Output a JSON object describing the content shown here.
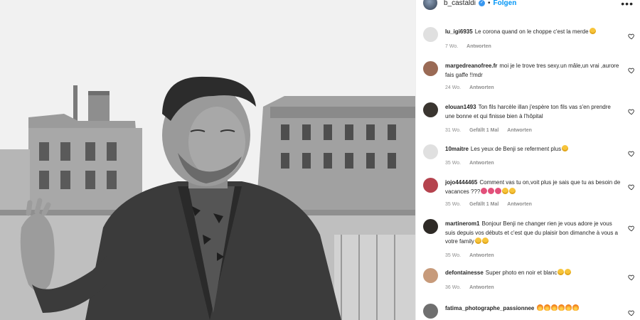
{
  "header": {
    "username": "b_castaldi",
    "separator": "•",
    "follow_label": "Folgen",
    "more_icon": "more-dots-icon"
  },
  "comments": [
    {
      "username": "lu_igi6935",
      "text": "Le corona quand on le choppe c'est la merde",
      "emojis": [
        "laugh"
      ],
      "time": "7 Wo.",
      "likes": "",
      "reply": "Antworten",
      "avatar_color": "#e0e0e0"
    },
    {
      "username": "margedreanofree.fr",
      "text": "moi je le trove tres sexy.un mâle,un vrai ,aurore fais gaffe !!mdr",
      "emojis": [],
      "time": "24 Wo.",
      "likes": "",
      "reply": "Antworten",
      "avatar_color": "#9a6a55"
    },
    {
      "username": "elouan1493",
      "text": "Ton fils harcèle illan j'espère ton fils vas s'en prendre une bonne et qui finisse bien à l'hôpital",
      "emojis": [],
      "time": "31 Wo.",
      "likes": "Gefällt 1 Mal",
      "reply": "Antworten",
      "avatar_color": "#3a3530"
    },
    {
      "username": "10maitre",
      "text": "Les yeux de Benji se referment plus",
      "emojis": [
        "laugh"
      ],
      "time": "35 Wo.",
      "likes": "",
      "reply": "Antworten",
      "avatar_color": "#e0e0e0"
    },
    {
      "username": "jojo4444465",
      "text": "Comment vas tu on,voit plus je sais que tu as besoin de vacances ???",
      "emojis": [
        "rose",
        "rose",
        "rose",
        "laugh",
        "laugh"
      ],
      "time": "35 Wo.",
      "likes": "Gefällt 1 Mal",
      "reply": "Antworten",
      "avatar_color": "#b5434e"
    },
    {
      "username": "martinerom1",
      "text": "Bonjour Benji ne changer rien je vous adore je vous suis depuis vos débuts et c'est que du plaisir bon dimanche à vous a votre family",
      "emojis": [
        "laugh",
        "laugh"
      ],
      "time": "35 Wo.",
      "likes": "",
      "reply": "Antworten",
      "avatar_color": "#2e2a26"
    },
    {
      "username": "defontainesse",
      "text": "Super photo en noir et blanc",
      "emojis": [
        "love",
        "love"
      ],
      "time": "36 Wo.",
      "likes": "",
      "reply": "Antworten",
      "avatar_color": "#c79a7a"
    },
    {
      "username": "fatima_photographe_passionnee",
      "text": "",
      "emojis": [
        "fire",
        "fire",
        "fire",
        "fire",
        "fire",
        "fire"
      ],
      "time": "",
      "likes": "",
      "reply": "",
      "avatar_color": "#6f6f6f"
    }
  ],
  "icons": {
    "like": "heart-icon",
    "verified": "verified-badge-icon"
  }
}
